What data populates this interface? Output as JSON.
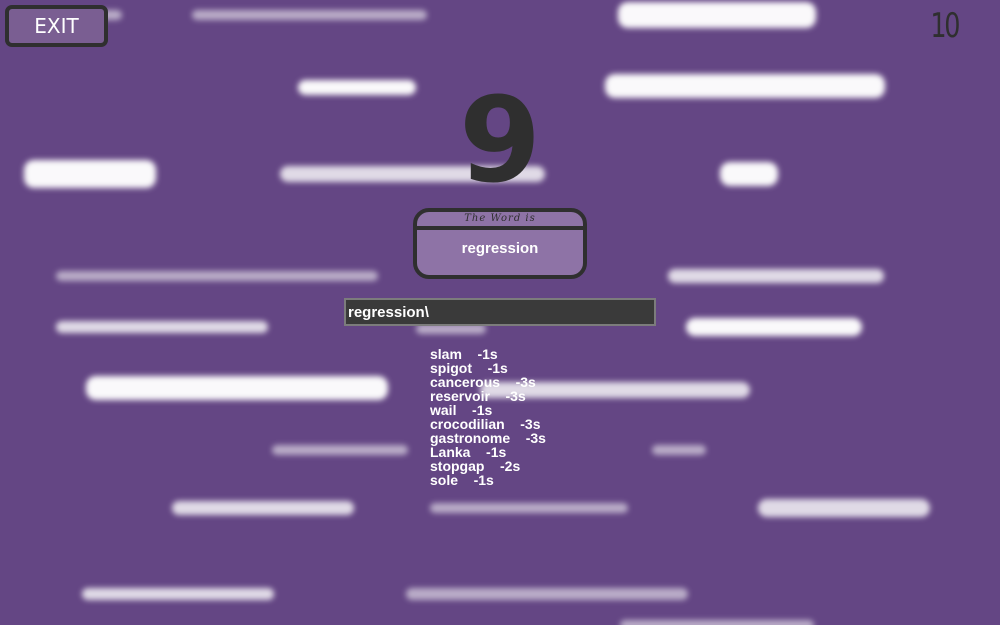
{
  "header": {
    "exit_label": "EXIT",
    "score": "10"
  },
  "timer": {
    "countdown": "9"
  },
  "word_panel": {
    "caption": "The Word is",
    "word": "regression"
  },
  "answer_input": {
    "value": "regression\\"
  },
  "guesses": [
    {
      "word": "slam",
      "penalty": "-1s"
    },
    {
      "word": "spigot",
      "penalty": "-1s"
    },
    {
      "word": "cancerous",
      "penalty": "-3s"
    },
    {
      "word": "reservoir",
      "penalty": "-3s"
    },
    {
      "word": "wail",
      "penalty": "-1s"
    },
    {
      "word": "crocodilian",
      "penalty": "-3s"
    },
    {
      "word": "gastronome",
      "penalty": "-3s"
    },
    {
      "word": "Lanka",
      "penalty": "-1s"
    },
    {
      "word": "stopgap",
      "penalty": "-2s"
    },
    {
      "word": "sole",
      "penalty": "-1s"
    }
  ],
  "colors": {
    "background": "#644684",
    "panel": "#8e73a6",
    "exit_button": "#7a5e92",
    "outline": "#2f2f2f",
    "input_background": "#3a3a3a"
  }
}
